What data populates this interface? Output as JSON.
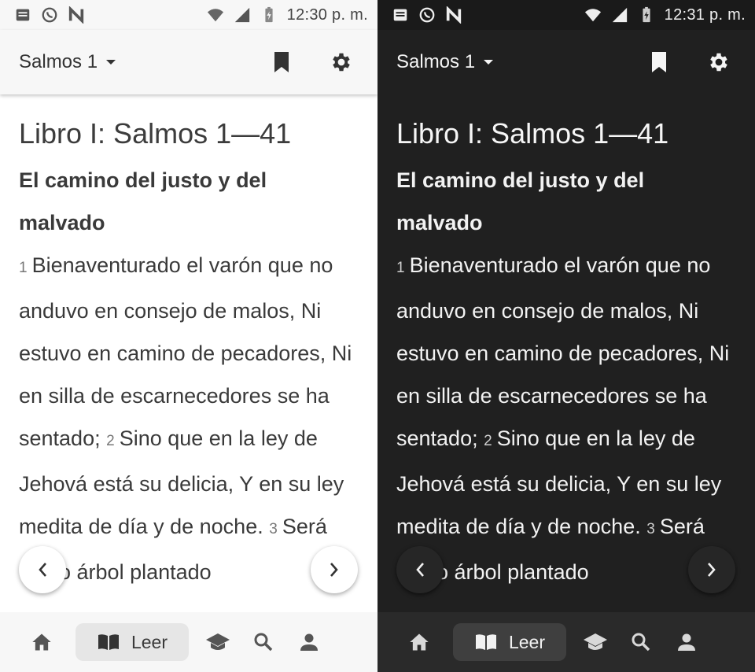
{
  "screens": [
    {
      "theme": "light",
      "status": {
        "time": "12:30 p. m."
      },
      "appbar": {
        "book_label": "Salmos 1"
      },
      "content": {
        "book_title": "Libro I: Salmos 1—41",
        "section_heading": "El camino del justo y del malvado",
        "verses": [
          {
            "num": "1",
            "text": "Bienaventurado el varón que no anduvo en consejo de malos, Ni estuvo en camino de pecadores, Ni en silla de escarnecedores se ha sentado;"
          },
          {
            "num": "2",
            "text": "Sino que en la ley de Jehová está su delicia, Y en su ley medita de día y de noche."
          },
          {
            "num": "3",
            "text": "Será como árbol plantado"
          }
        ]
      },
      "bottom_nav": {
        "active_label": "Leer"
      }
    },
    {
      "theme": "dark",
      "status": {
        "time": "12:31 p. m."
      },
      "appbar": {
        "book_label": "Salmos 1"
      },
      "content": {
        "book_title": "Libro I: Salmos 1—41",
        "section_heading": "El camino del justo y del malvado",
        "verses": [
          {
            "num": "1",
            "text": "Bienaventurado el varón que no anduvo en consejo de malos, Ni estuvo en camino de pecadores, Ni en silla de escarnecedores se ha sentado;"
          },
          {
            "num": "2",
            "text": "Sino que en la ley de Jehová está su delicia, Y en su ley medita de día y de noche."
          },
          {
            "num": "3",
            "text": "Será como árbol plantado"
          }
        ]
      },
      "bottom_nav": {
        "active_label": "Leer"
      }
    }
  ],
  "icons": {
    "status_left": [
      "news-icon",
      "whatsapp-icon",
      "n-app-icon"
    ],
    "status_right": [
      "wifi-icon",
      "signal-icon",
      "battery-icon"
    ],
    "appbar": [
      "dropdown-arrow-icon",
      "bookmark-icon",
      "settings-gear-icon"
    ],
    "navigation": [
      "chevron-left-icon",
      "chevron-right-icon"
    ],
    "bottom_nav": [
      "home-icon",
      "book-open-icon",
      "school-icon",
      "search-icon",
      "person-icon"
    ]
  },
  "colors": {
    "light_background": "#ffffff",
    "light_text": "#3a3a3a",
    "dark_background": "#202020",
    "dark_text": "#f2f2f2"
  }
}
